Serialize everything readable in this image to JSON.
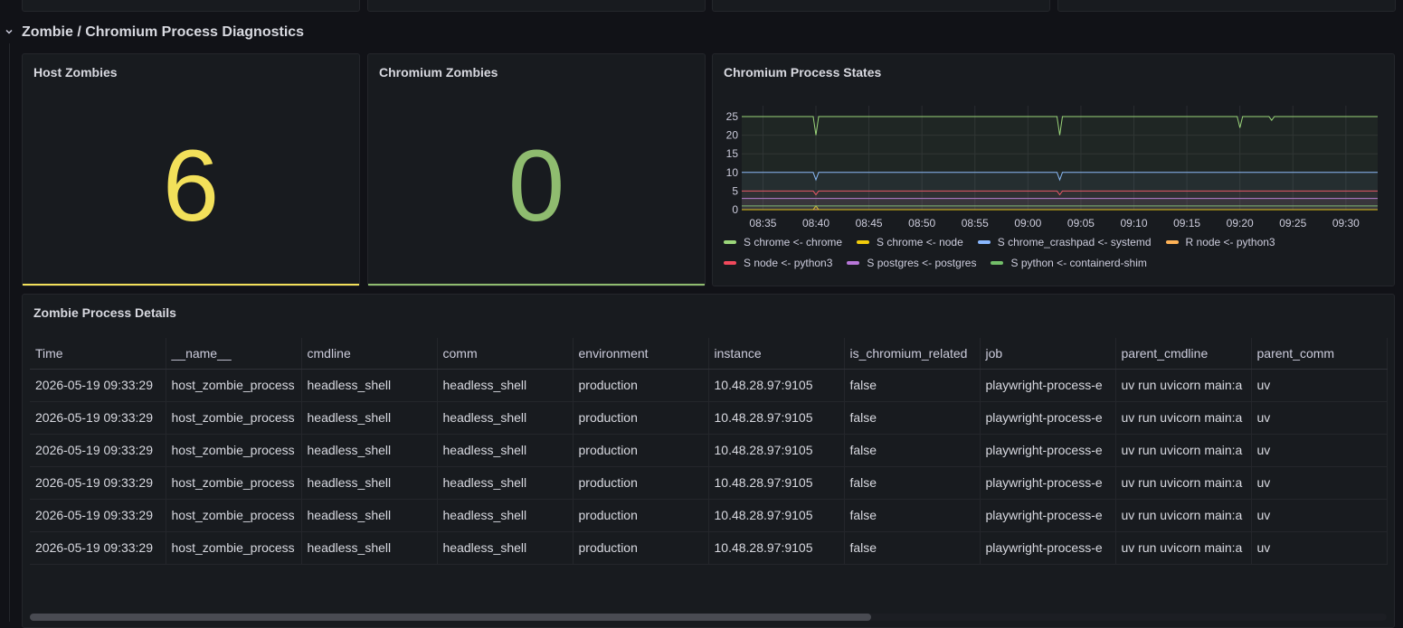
{
  "row": {
    "title": "Zombie / Chromium Process Diagnostics",
    "collapse_icon": "chevron-down-icon"
  },
  "host_zombies": {
    "title": "Host Zombies",
    "value": "6",
    "color": "#f2e05a"
  },
  "chromium_zombies": {
    "title": "Chromium Zombies",
    "value": "0",
    "color": "#8fbc6f"
  },
  "process_states": {
    "title": "Chromium Process States",
    "legend": [
      {
        "label": "S chrome <- chrome",
        "color": "#9bd67a"
      },
      {
        "label": "S chrome <- node",
        "color": "#f2cc0c"
      },
      {
        "label": "S chrome_crashpad <- systemd",
        "color": "#8ab8ff"
      },
      {
        "label": "R node <- python3",
        "color": "#ffb357"
      },
      {
        "label": "S node <- python3",
        "color": "#f2495c"
      },
      {
        "label": "S postgres <- postgres",
        "color": "#b877d9"
      },
      {
        "label": "S python <- containerd-shim",
        "color": "#73bf69"
      }
    ]
  },
  "chart_data": {
    "type": "line",
    "title": "Chromium Process States",
    "x": [
      "08:33",
      "08:35",
      "08:40",
      "08:45",
      "08:50",
      "08:55",
      "09:00",
      "09:03",
      "09:05",
      "09:10",
      "09:15",
      "09:20",
      "09:23",
      "09:25",
      "09:30",
      "09:33"
    ],
    "x_ticks": [
      "08:35",
      "08:40",
      "08:45",
      "08:50",
      "08:55",
      "09:00",
      "09:05",
      "09:10",
      "09:15",
      "09:20",
      "09:25",
      "09:30"
    ],
    "y_ticks": [
      0,
      5,
      10,
      15,
      20,
      25
    ],
    "ylim": [
      0,
      25
    ],
    "grid": true,
    "legend_position": "bottom",
    "series": [
      {
        "name": "S chrome <- chrome",
        "color": "#9bd67a",
        "values": [
          25,
          25,
          25,
          25,
          25,
          25,
          25,
          25,
          25,
          25,
          25,
          25,
          25,
          25,
          25,
          25
        ],
        "dips": [
          {
            "x": "08:40",
            "y": 20
          },
          {
            "x": "09:03",
            "y": 20
          },
          {
            "x": "09:20",
            "y": 22
          },
          {
            "x": "09:23",
            "y": 24
          }
        ]
      },
      {
        "name": "S chrome_crashpad <- systemd",
        "color": "#8ab8ff",
        "values": [
          10,
          10,
          10,
          10,
          10,
          10,
          10,
          10,
          10,
          10,
          10,
          10,
          10,
          10,
          10,
          10
        ],
        "dips": [
          {
            "x": "08:40",
            "y": 8
          },
          {
            "x": "09:03",
            "y": 8
          }
        ]
      },
      {
        "name": "S node <- python3",
        "color": "#f2495c",
        "values": [
          5,
          5,
          5,
          5,
          5,
          5,
          5,
          5,
          5,
          5,
          5,
          5,
          5,
          5,
          5,
          5
        ],
        "dips": [
          {
            "x": "08:40",
            "y": 4
          },
          {
            "x": "09:03",
            "y": 4
          }
        ]
      },
      {
        "name": "S postgres <- postgres",
        "color": "#b877d9",
        "values": [
          3,
          3,
          3,
          3,
          3,
          3,
          3,
          3,
          3,
          3,
          3,
          3,
          3,
          3,
          3,
          3
        ],
        "dips": []
      },
      {
        "name": "S python <- containerd-shim",
        "color": "#73bf69",
        "values": [
          1,
          1,
          1,
          1,
          1,
          1,
          1,
          1,
          1,
          1,
          1,
          1,
          1,
          1,
          1,
          1
        ],
        "dips": []
      },
      {
        "name": "S chrome <- node",
        "color": "#f2cc0c",
        "values": [
          0,
          0,
          0,
          0,
          0,
          0,
          0,
          0,
          0,
          0,
          0,
          0,
          0,
          0,
          0,
          0
        ],
        "dips": [
          {
            "x": "08:40",
            "y": 1
          }
        ]
      },
      {
        "name": "R node <- python3",
        "color": "#ffb357",
        "values": [
          0,
          0,
          0,
          0,
          0,
          0,
          0,
          0,
          0,
          0,
          0,
          0,
          0,
          0,
          0,
          0
        ],
        "dips": []
      }
    ]
  },
  "details": {
    "title": "Zombie Process Details",
    "columns": [
      "Time",
      "__name__",
      "cmdline",
      "comm",
      "environment",
      "instance",
      "is_chromium_related",
      "job",
      "parent_cmdline",
      "parent_comm"
    ],
    "rows": [
      [
        "2026-05-19 09:33:29",
        "host_zombie_process",
        "headless_shell",
        "headless_shell",
        "production",
        "10.48.28.97:9105",
        "false",
        "playwright-process-e",
        "uv run uvicorn main:a",
        "uv"
      ],
      [
        "2026-05-19 09:33:29",
        "host_zombie_process",
        "headless_shell",
        "headless_shell",
        "production",
        "10.48.28.97:9105",
        "false",
        "playwright-process-e",
        "uv run uvicorn main:a",
        "uv"
      ],
      [
        "2026-05-19 09:33:29",
        "host_zombie_process",
        "headless_shell",
        "headless_shell",
        "production",
        "10.48.28.97:9105",
        "false",
        "playwright-process-e",
        "uv run uvicorn main:a",
        "uv"
      ],
      [
        "2026-05-19 09:33:29",
        "host_zombie_process",
        "headless_shell",
        "headless_shell",
        "production",
        "10.48.28.97:9105",
        "false",
        "playwright-process-e",
        "uv run uvicorn main:a",
        "uv"
      ],
      [
        "2026-05-19 09:33:29",
        "host_zombie_process",
        "headless_shell",
        "headless_shell",
        "production",
        "10.48.28.97:9105",
        "false",
        "playwright-process-e",
        "uv run uvicorn main:a",
        "uv"
      ],
      [
        "2026-05-19 09:33:29",
        "host_zombie_process",
        "headless_shell",
        "headless_shell",
        "production",
        "10.48.28.97:9105",
        "false",
        "playwright-process-e",
        "uv run uvicorn main:a",
        "uv"
      ]
    ],
    "scroll_fraction": 0.62
  }
}
